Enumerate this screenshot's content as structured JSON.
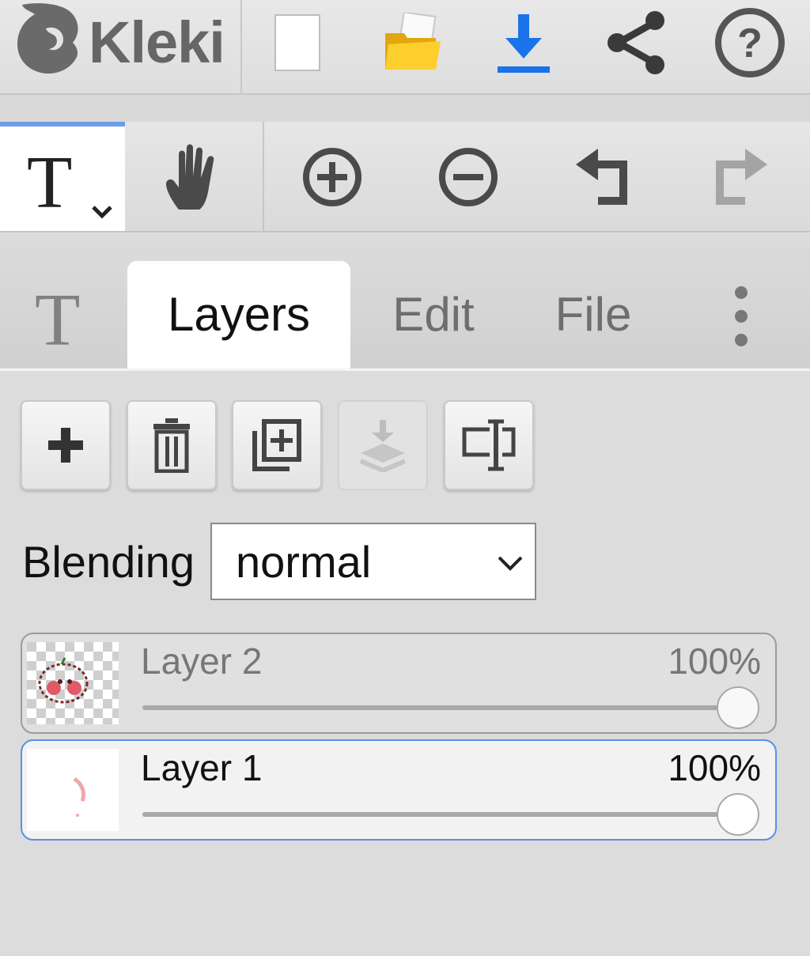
{
  "app": {
    "title": "Kleki"
  },
  "topbar": {
    "icons": [
      "new-image-icon",
      "open-folder-icon",
      "download-icon",
      "share-icon",
      "help-icon"
    ],
    "download_color": "#1a73e8",
    "folder_color": "#f5c518"
  },
  "toolbar": {
    "active_tool_glyph": "T",
    "tools": [
      "text-tool",
      "hand-tool",
      "zoom-in",
      "zoom-out",
      "undo",
      "redo"
    ],
    "accent": "#6d9ce8"
  },
  "tabs": {
    "icon_glyph": "T",
    "items": [
      {
        "label": "Layers",
        "active": true
      },
      {
        "label": "Edit",
        "active": false
      },
      {
        "label": "File",
        "active": false
      }
    ]
  },
  "layer_actions": [
    "add-layer",
    "delete-layer",
    "duplicate-layer",
    "merge-down (disabled)",
    "rename-layer"
  ],
  "blending": {
    "label": "Blending",
    "value": "normal"
  },
  "layers": [
    {
      "name": "Layer 2",
      "opacity": "100%",
      "opacity_value": 1.0,
      "selected": false
    },
    {
      "name": "Layer 1",
      "opacity": "100%",
      "opacity_value": 1.0,
      "selected": true
    }
  ]
}
